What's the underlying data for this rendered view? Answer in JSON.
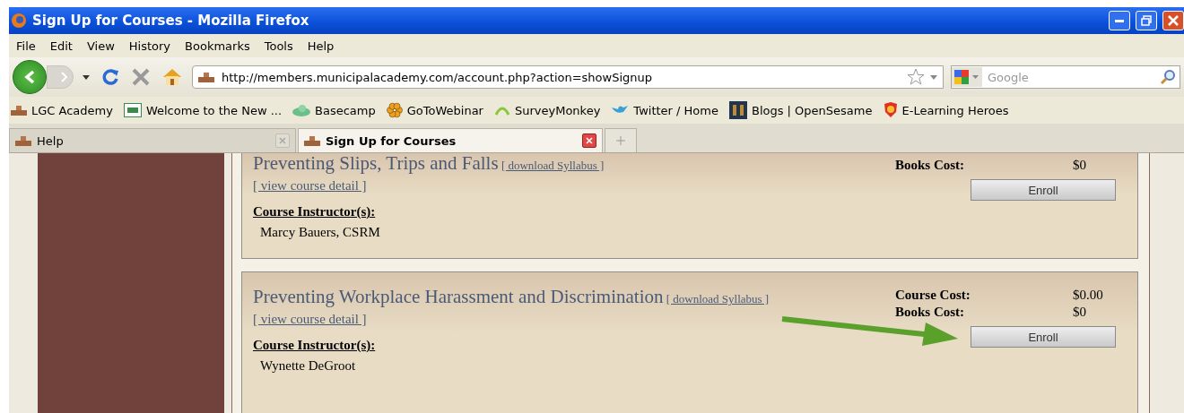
{
  "window": {
    "title": "Sign Up for Courses - Mozilla Firefox"
  },
  "menu": [
    "File",
    "Edit",
    "View",
    "History",
    "Bookmarks",
    "Tools",
    "Help"
  ],
  "address": {
    "value": "http://members.municipalacademy.com/account.php?action=showSignup"
  },
  "search": {
    "placeholder": "Google"
  },
  "bookmarks": [
    {
      "label": "LGC Academy",
      "kind": "site"
    },
    {
      "label": "Welcome to the New ...",
      "kind": "lgc"
    },
    {
      "label": "Basecamp",
      "kind": "cloud"
    },
    {
      "label": "GoToWebinar",
      "kind": "flower"
    },
    {
      "label": "SurveyMonkey",
      "kind": "monkey"
    },
    {
      "label": "Twitter / Home",
      "kind": "bird"
    },
    {
      "label": "Blogs | OpenSesame",
      "kind": "grid"
    },
    {
      "label": "E-Learning Heroes",
      "kind": "shield"
    }
  ],
  "tabs": [
    {
      "label": "Help",
      "selected": false
    },
    {
      "label": "Sign Up for Courses",
      "selected": true
    }
  ],
  "courses": [
    {
      "title": "Preventing Slips, Trips and Falls",
      "syllabus": "[ download Syllabus ]",
      "detail": "[ view course detail ]",
      "instructor_label": "Course Instructor(s):",
      "instructor": "Marcy Bauers, CSRM",
      "costs": [
        {
          "label": "Books Cost:",
          "value": "$0"
        }
      ],
      "enroll": "Enroll",
      "highlighted": false
    },
    {
      "title": "Preventing Workplace Harassment and Discrimination",
      "syllabus": "[ download Syllabus ]",
      "detail": "[ view course detail ]",
      "instructor_label": "Course Instructor(s):",
      "instructor": "Wynette DeGroot",
      "costs": [
        {
          "label": "Course Cost:",
          "value": "$0.00"
        },
        {
          "label": "Books Cost:",
          "value": "$0"
        }
      ],
      "enroll": "Enroll",
      "highlighted": true
    }
  ]
}
